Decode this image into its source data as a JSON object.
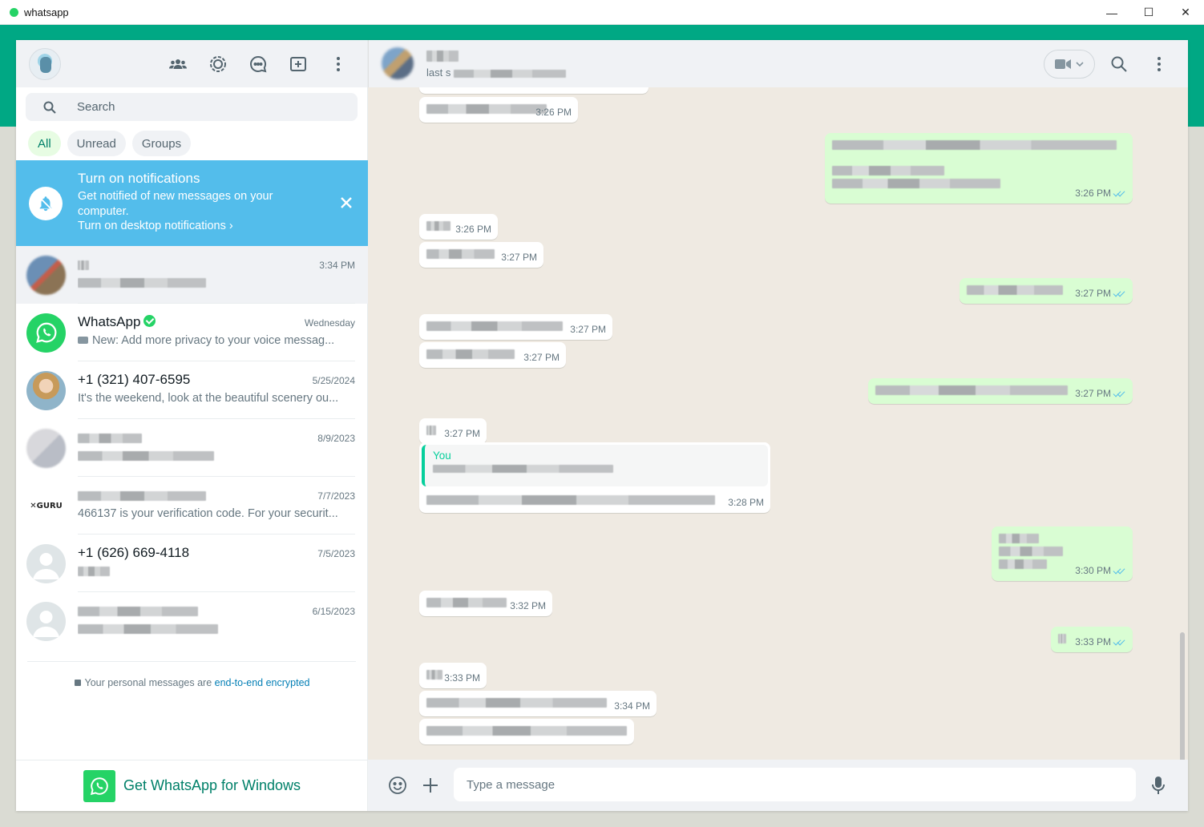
{
  "window": {
    "title": "whatsapp",
    "controls": {
      "minimize": "—",
      "maximize": "☐",
      "close": "✕"
    }
  },
  "sidebar": {
    "search": {
      "placeholder": "Search"
    },
    "filters": [
      "All",
      "Unread",
      "Groups"
    ],
    "notification": {
      "title": "Turn on notifications",
      "body": "Get notified of new messages on your computer.",
      "link": "Turn on desktop notifications ›"
    },
    "chats": [
      {
        "name": "",
        "time": "3:34 PM",
        "preview": ""
      },
      {
        "name": "WhatsApp",
        "time": "Wednesday",
        "preview": "New: Add more privacy to your voice messag..."
      },
      {
        "name": "+1 (321) 407-6595",
        "time": "5/25/2024",
        "preview": "It's the weekend, look at the beautiful scenery ou..."
      },
      {
        "name": "",
        "time": "8/9/2023",
        "preview": ""
      },
      {
        "name": "",
        "time": "7/7/2023",
        "preview": "466137 is your verification code. For your securit..."
      },
      {
        "name": "+1 (626) 669-4118",
        "time": "7/5/2023",
        "preview": ""
      },
      {
        "name": "",
        "time": "6/15/2023",
        "preview": ""
      }
    ],
    "encryption": {
      "prefix": "Your personal messages are ",
      "link": "end-to-end encrypted"
    },
    "get_app": "Get WhatsApp for Windows"
  },
  "conversation": {
    "subtitle": "last s",
    "messages": [
      {
        "dir": "in",
        "time": "3:26 PM"
      },
      {
        "dir": "out",
        "time": "3:26 PM"
      },
      {
        "dir": "in",
        "time": "3:26 PM"
      },
      {
        "dir": "in",
        "time": "3:27 PM"
      },
      {
        "dir": "out",
        "time": "3:27 PM"
      },
      {
        "dir": "in",
        "time": "3:27 PM"
      },
      {
        "dir": "in",
        "time": "3:27 PM"
      },
      {
        "dir": "out",
        "time": "3:27 PM"
      },
      {
        "dir": "in",
        "time": "3:27 PM"
      },
      {
        "dir": "in",
        "time": "3:28 PM",
        "quote_author": "You"
      },
      {
        "dir": "out",
        "time": "3:30 PM"
      },
      {
        "dir": "in",
        "time": "3:32 PM"
      },
      {
        "dir": "out",
        "time": "3:33 PM"
      },
      {
        "dir": "in",
        "time": "3:33 PM"
      },
      {
        "dir": "in",
        "time": "3:34 PM"
      },
      {
        "dir": "in",
        "time": ""
      }
    ],
    "composer": {
      "placeholder": "Type a message"
    }
  },
  "colors": {
    "brand": "#00a884",
    "notification_bg": "#53bdeb",
    "outgoing_bubble": "#d9fdd3",
    "chat_bg": "#efeae2",
    "read_ticks": "#53bdeb"
  },
  "icons": [
    "communities-icon",
    "status-icon",
    "channels-icon",
    "new-chat-icon",
    "menu-icon",
    "search-icon",
    "bell-off-icon",
    "close-icon",
    "video-call-icon",
    "emoji-icon",
    "attach-plus-icon",
    "microphone-icon",
    "lock-icon",
    "whatsapp-logo-icon"
  ]
}
